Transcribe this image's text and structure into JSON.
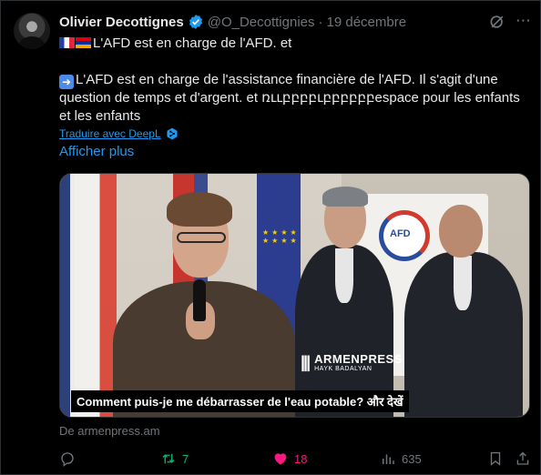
{
  "author": {
    "name": "Olivier Decottignes",
    "handle": "@O_Decottignies",
    "separator": "·",
    "date": "19 décembre"
  },
  "tweet": {
    "line1": "L'AFD est en charge de l'AFD. et",
    "paragraph": "L'AFD est en charge de l'assistance financière de l'AFD. Il s'agit d'une question de temps et d'argent. et ռււբբբբւբբբբբբespace pour les enfants et les enfants",
    "translate_label": "Traduire avec DeepL",
    "show_more": "Afficher plus"
  },
  "media": {
    "watermark_brand": "ARMENPRESS",
    "watermark_author": "HAYK BADALYAN",
    "afd_logo": "AFD",
    "caption": "Comment puis-je me débarrasser de l'eau potable? और देखें"
  },
  "source": "De armenpress.am",
  "actions": {
    "retweets": "7",
    "likes": "18",
    "views": "635"
  },
  "colors": {
    "background": "#000000",
    "text": "#e7e9ea",
    "muted": "#71767b",
    "link": "#1d9bf0",
    "retweet": "#00ba7c",
    "like": "#f91880"
  }
}
